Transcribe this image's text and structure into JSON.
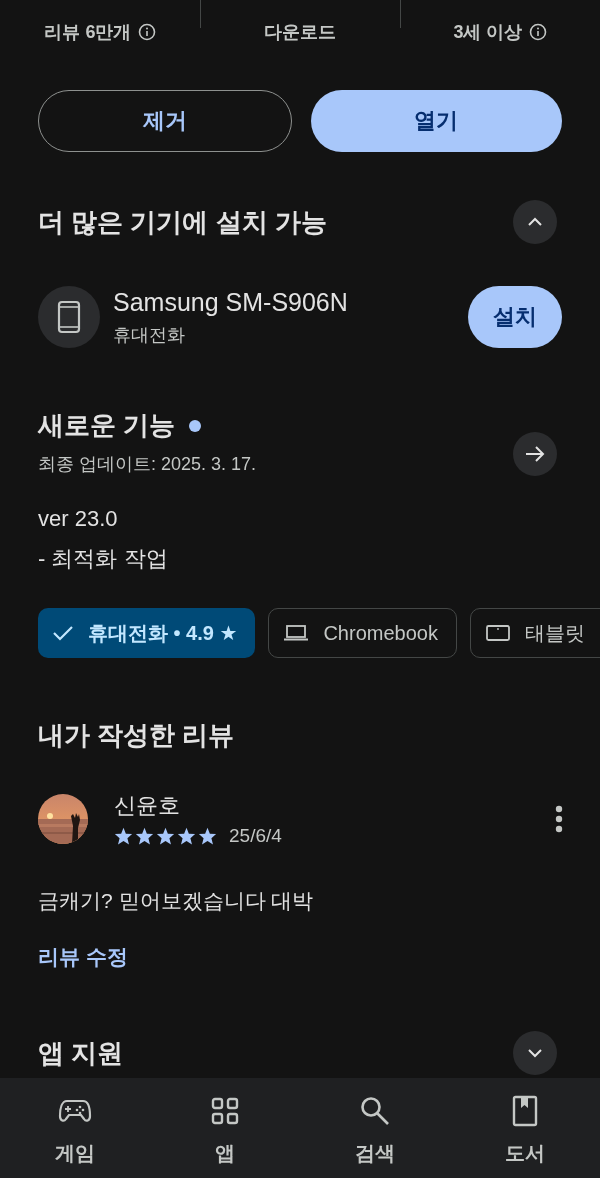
{
  "stats": [
    {
      "label": "리뷰 6만개",
      "info": true
    },
    {
      "label": "다운로드",
      "info": false
    },
    {
      "label": "3세 이상",
      "info": true
    }
  ],
  "actions": [
    {
      "label": "제거",
      "kind": "outlined"
    },
    {
      "label": "열기",
      "kind": "filled"
    }
  ],
  "install_section": {
    "title": "더 많은 기기에 설치 가능",
    "expanded": true,
    "device": {
      "name": "Samsung SM-S906N",
      "type": "휴대전화",
      "button": "설치"
    }
  },
  "whats_new": {
    "title": "새로운 기능",
    "new": true,
    "updated": "최종 업데이트: 2025. 3. 17.",
    "notes": [
      "ver 23.0",
      "- 최적화 작업"
    ]
  },
  "device_chips": [
    {
      "label": "휴대전화 • 4.9 ★",
      "selected": true
    },
    {
      "label": "Chromebook",
      "kind": "laptop",
      "selected": false
    },
    {
      "label": "태블릿",
      "kind": "tablet",
      "selected": false
    }
  ],
  "my_review": {
    "title": "내가 작성한 리뷰",
    "author": "신윤호",
    "stars": 5,
    "date": "25/6/4",
    "text": "금캐기? 믿어보겠습니다 대박",
    "edit_link": "리뷰 수정"
  },
  "app_support": {
    "title": "앱 지원",
    "expanded": false
  },
  "nav": [
    {
      "label": "게임",
      "kind": "games"
    },
    {
      "label": "앱",
      "kind": "apps"
    },
    {
      "label": "검색",
      "kind": "search"
    },
    {
      "label": "도서",
      "kind": "books"
    }
  ]
}
